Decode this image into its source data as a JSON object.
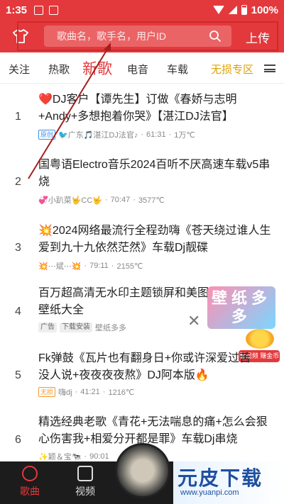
{
  "status_bar": {
    "time": "1:35",
    "battery": "100%"
  },
  "header": {
    "search_placeholder": "歌曲名，歌手名，用户ID",
    "upload_label": "上传"
  },
  "tabs": [
    {
      "label": "关注"
    },
    {
      "label": "热歌"
    },
    {
      "label": "新歌"
    },
    {
      "label": "电音"
    },
    {
      "label": "车载"
    },
    {
      "label": "无损专区"
    }
  ],
  "songs": [
    {
      "rank": "1",
      "title": "❤️DJ客户【谭先生】订做《春娇与志明+Andy+多想抱着你哭》【湛江DJ法官】",
      "badge": "原创",
      "uploader": "🐦广东🎵湛江DJ法官♪",
      "duration": "61:31",
      "heat": "1万℃"
    },
    {
      "rank": "2",
      "title": "国粤语Electro音乐2024百听不厌高速车载v5串烧",
      "badge": "",
      "uploader": "💞小趴菜🤟CC🤟",
      "duration": "70:47",
      "heat": "3577℃"
    },
    {
      "rank": "3",
      "title": "💥2024网络最流行全程劲嗨《苍天绕过谁人生爱到九十九依然茫然》车载Dj靓碟",
      "badge": "",
      "uploader": "💥⋯斌⋯💥",
      "duration": "79:11",
      "heat": "2155℃"
    },
    {
      "rank": "5",
      "title": "Fk弹鼓《瓦片也有翻身日+你或许深爱过苦没人说+夜夜夜夜熬》DJ阿本版🔥",
      "badge": "无损",
      "uploader": "嗨dj",
      "duration": "41:21",
      "heat": "1216℃"
    },
    {
      "rank": "6",
      "title": "精选经典老歌《青花+无法喘息的痛+怎么会狠心伤害我+相爱分开都是罪》车载Dj串烧",
      "badge": "",
      "uploader": "✨颖＆宝🐄",
      "duration": "90:01",
      "heat": ""
    }
  ],
  "ad": {
    "rank": "4",
    "title": "百万超高清无水印主题锁屏和美图壁纸大全",
    "tag_ad": "广告",
    "tag_download": "下载安装",
    "source": "壁纸多多",
    "banner_text": "壁纸多多",
    "coin_label": "看视频 赚金币"
  },
  "bottom_nav": [
    {
      "label": "歌曲"
    },
    {
      "label": "视频"
    }
  ],
  "watermark": {
    "text": "元皮下载",
    "url": "www.yuanpi.com"
  },
  "colors": {
    "brand_red": "#e4393c",
    "gold": "#e0a000"
  }
}
